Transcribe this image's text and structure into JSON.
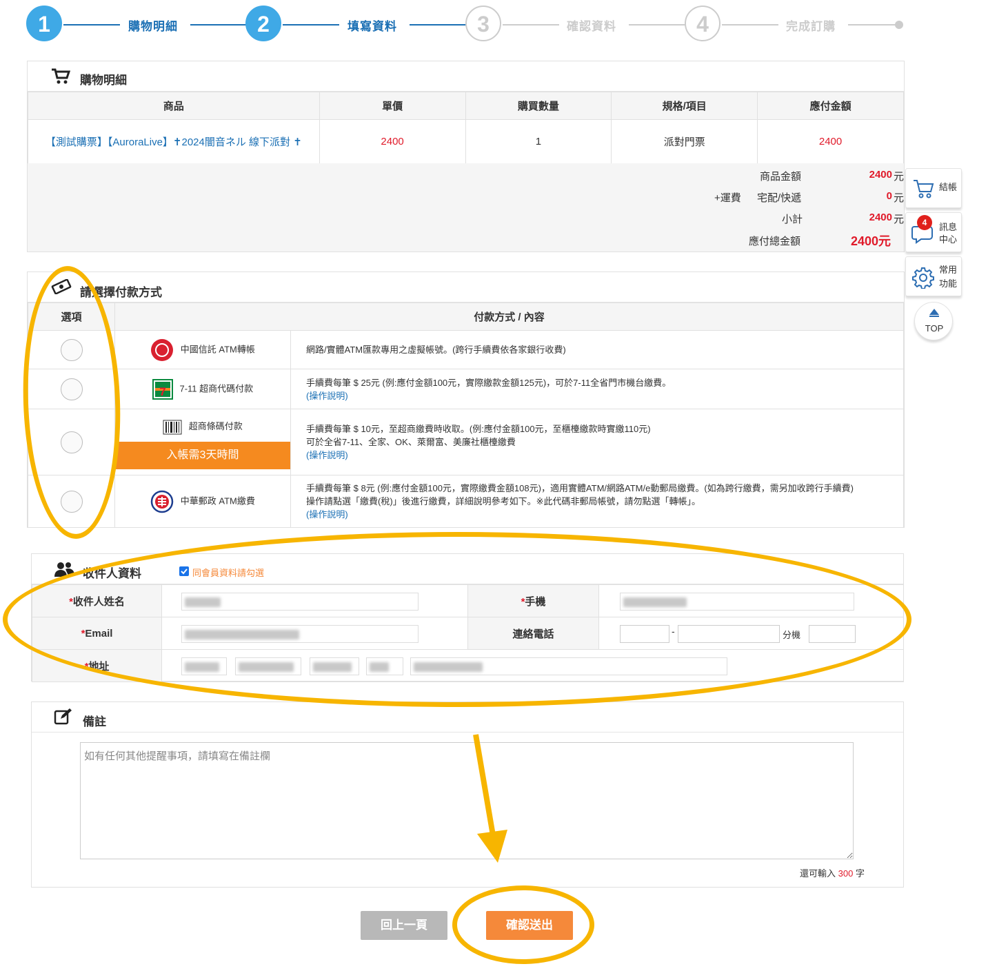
{
  "steps": [
    {
      "num": "1",
      "label": "購物明細"
    },
    {
      "num": "2",
      "label": "填寫資料"
    },
    {
      "num": "3",
      "label": "確認資料"
    },
    {
      "num": "4",
      "label": "完成訂購"
    }
  ],
  "cart": {
    "title": "購物明細",
    "headers": [
      "商品",
      "單價",
      "購買數量",
      "規格/項目",
      "應付金額"
    ],
    "row": {
      "product": "【測試購票】【AuroraLive】✝2024闇音ネル 線下派對 ✝",
      "price": "2400",
      "qty": "1",
      "spec": "派對門票",
      "amount": "2400"
    },
    "summary": {
      "goods_label": "商品金額",
      "goods_value": "2400",
      "shipping_prefix": "+運費",
      "shipping_label": "宅配/快遞",
      "shipping_value": "0",
      "subtotal_label": "小計",
      "subtotal_value": "2400",
      "total_label": "應付總金額",
      "total_value": "2400元",
      "currency": "元"
    }
  },
  "payment": {
    "title": "請選擇付款方式",
    "headers": [
      "選項",
      "付款方式 / 內容"
    ],
    "methods": [
      {
        "name": "中國信託 ATM轉帳",
        "desc": "網路/實體ATM匯款專用之虛擬帳號。(跨行手續費依各家銀行收費)",
        "desc2": "",
        "link": ""
      },
      {
        "name": "7-11 超商代碼付款",
        "desc": "手續費每筆 $ 25元 (例:應付金額100元，實際繳款金額125元)，可於7-11全省門市機台繳費。",
        "desc2": "",
        "link": "(操作說明)"
      },
      {
        "name": "超商條碼付款",
        "badge": "入帳需3天時間",
        "desc": "手續費每筆 $ 10元，至超商繳費時收取。(例:應付金額100元，至櫃檯繳款時實繳110元)",
        "desc2": "可於全省7-11、全家、OK、萊爾富、美廉社櫃檯繳費",
        "link": "(操作說明)"
      },
      {
        "name": "中華郵政 ATM繳費",
        "desc": "手續費每筆 $ 8元 (例:應付金額100元，實際繳費金額108元)，適用實體ATM/網路ATM/e動郵局繳費。(如為跨行繳費，需另加收跨行手續費)",
        "desc2": "操作請點選「繳費(稅)」後進行繳費，詳細說明參考如下。※此代碼非郵局帳號，請勿點選「轉帳」。",
        "link": "(操作說明)"
      }
    ]
  },
  "recipient": {
    "title": "收件人資料",
    "same_as_member": "同會員資料請勾選",
    "name_label": "收件人姓名",
    "mobile_label": "手機",
    "email_label": "Email",
    "phone_label": "連絡電話",
    "ext_label": "分機",
    "phone_dash": "-",
    "address_label": "地址",
    "required_mark": "*"
  },
  "note": {
    "title": "備註",
    "placeholder": "如有任何其他提醒事項，請填寫在備註欄",
    "remain_prefix": "還可輸入",
    "remain_count": "300",
    "remain_suffix": "字"
  },
  "buttons": {
    "back": "回上一頁",
    "submit": "確認送出"
  },
  "dock": {
    "checkout": "結帳",
    "messages_line1": "訊息",
    "messages_line2": "中心",
    "messages_badge": "4",
    "functions_line1": "常用",
    "functions_line2": "功能",
    "top": "TOP"
  },
  "colors": {
    "accent_blue": "#3fa9e6",
    "link_blue": "#1a6fb4",
    "price_red": "#e01a2a",
    "submit_orange": "#f5893a",
    "back_gray": "#b8b8b8",
    "annotation_yellow": "#f7b500"
  }
}
